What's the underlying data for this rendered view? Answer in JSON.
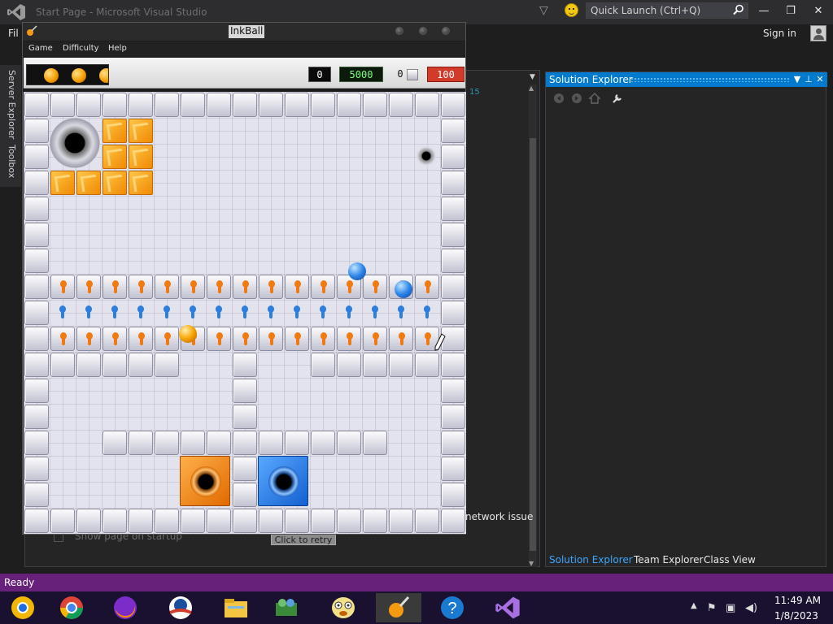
{
  "vs": {
    "title": "Start Page - Microsoft Visual Studio",
    "quick_launch_placeholder": "Quick Launch (Ctrl+Q)",
    "menu_file": "Fil",
    "sign_in": "Sign in",
    "rail_server_explorer": "Server Explorer",
    "rail_toolbox": "Toolbox",
    "editor_line_number": "15",
    "network_issue": "network issue",
    "retry_label": "Click to retry",
    "show_startup": "Show page on startup",
    "status": "Ready",
    "accent_color": "#007acc",
    "status_bar_color": "#68217a"
  },
  "solution_explorer": {
    "title": "Solution Explorer",
    "tabs": [
      "Solution Explorer",
      "Team Explorer",
      "Class View"
    ]
  },
  "inkball": {
    "title": "InkBall",
    "menu": [
      "Game",
      "Difficulty",
      "Help"
    ],
    "score": "0",
    "target": "5000",
    "blocks": "0",
    "timer": "100",
    "queue_balls": [
      "orange",
      "orange",
      "orange"
    ],
    "board_balls": [
      {
        "color": "blue",
        "col": 12.8,
        "row": 6.9
      },
      {
        "color": "blue",
        "col": 14.6,
        "row": 7.6
      },
      {
        "color": "orange",
        "col": 6.3,
        "row": 9.3
      }
    ]
  },
  "taskbar": {
    "apps": [
      "chrome-canary",
      "chrome",
      "firefox",
      "obama-logo",
      "file-explorer",
      "network-people",
      "troll-face",
      "inkball",
      "help",
      "visual-studio"
    ],
    "time": "11:49 AM",
    "date": "1/8/2023"
  }
}
